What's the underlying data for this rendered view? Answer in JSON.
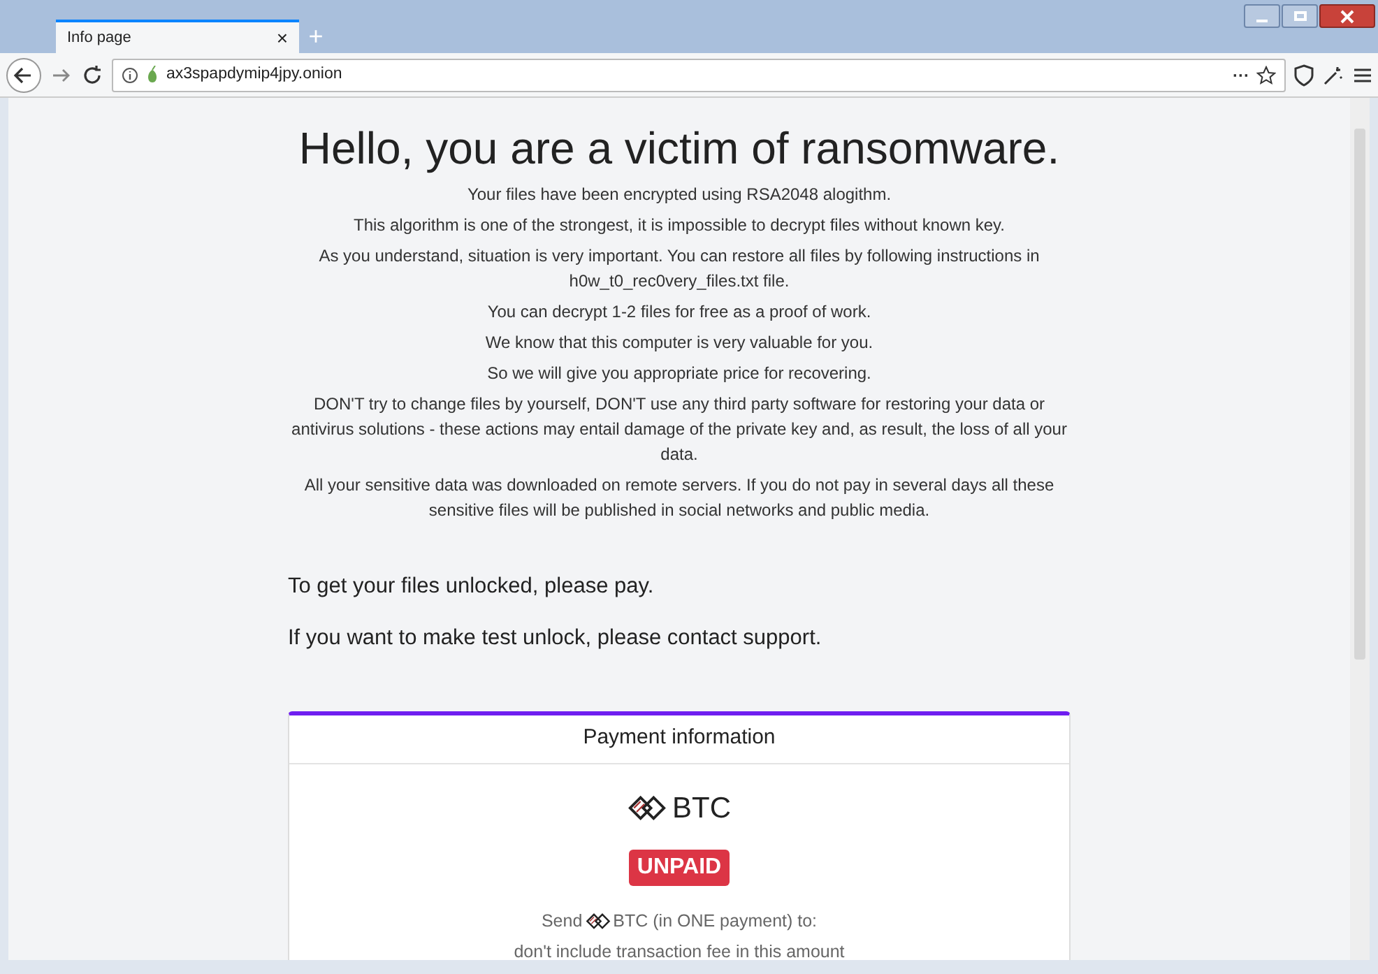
{
  "tabs": [
    {
      "label": "Info page",
      "selected": true,
      "close": "×"
    }
  ],
  "new_tab": "+",
  "address_bar": {
    "url": "ax3spapdymip4jpy.onion"
  },
  "toolbar": {
    "more": "···"
  },
  "page": {
    "heading": "Hello, you are a victim of ransomware.",
    "paragraphs": [
      "Your files have been encrypted using RSA2048 alogithm.",
      "This algorithm is one of the strongest, it is impossible to decrypt files without known key.",
      "As you understand, situation is very important. You can restore all files by following instructions in h0w_t0_rec0very_files.txt file.",
      "You can decrypt 1-2 files for free as a proof of work.",
      "We know that this computer is very valuable for you.",
      "So we will give you appropriate price for recovering.",
      "DON'T try to change files by yourself, DON'T use any third party software for restoring your data or antivirus solutions - these actions may entail damage of the private key and, as result, the loss of all your data.",
      "All your sensitive data was downloaded on remote servers. If you do not pay in several days all these sensitive files will be published in social networks and public media."
    ],
    "instructions": [
      "To get your files unlocked, please pay.",
      "If you want to make test unlock, please contact support."
    ],
    "payment": {
      "title": "Payment information",
      "currency": "BTC",
      "status": {
        "label": "UNPAID",
        "paid": false
      },
      "send_prefix": "Send",
      "send_suffix": "BTC (in ONE payment) to:",
      "fee_note": "don't include transaction fee in this amount"
    }
  }
}
